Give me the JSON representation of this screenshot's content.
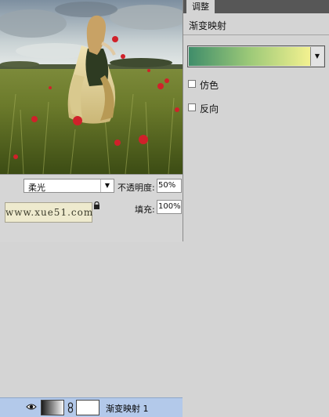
{
  "layers_panel": {
    "blend_mode": "柔光",
    "opacity_label": "不透明度:",
    "opacity_value": "50%",
    "fill_label": "填充:",
    "fill_value": "100%",
    "layer_name": "渐变映射 1"
  },
  "watermark_text": "www.xue51.com",
  "adjustments_panel": {
    "tab_label": "调整",
    "title": "渐变映射",
    "gradient": {
      "start_color": "#3f8d6a",
      "mid_color": "#9cc978",
      "end_color": "#f3f190"
    },
    "checkboxes": [
      {
        "label": "仿色",
        "checked": false
      },
      {
        "label": "反向",
        "checked": false
      }
    ]
  },
  "icons": [
    "eye-icon",
    "lock-icon",
    "chain-icon",
    "dropdown-arrow-icon"
  ]
}
